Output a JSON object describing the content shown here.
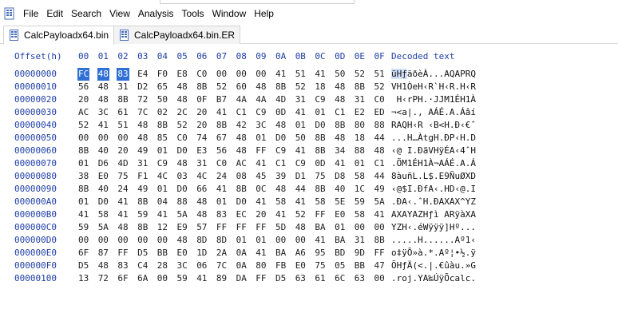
{
  "menu": {
    "items": [
      "File",
      "Edit",
      "Search",
      "View",
      "Analysis",
      "Tools",
      "Window",
      "Help"
    ]
  },
  "tabs": [
    {
      "label": "CalcPayloadx64.bin",
      "active": true
    },
    {
      "label": "CalcPayloadx64.bin.ER",
      "active": false
    }
  ],
  "hex": {
    "offset_header": "Offset(h)",
    "column_headers": [
      "00",
      "01",
      "02",
      "03",
      "04",
      "05",
      "06",
      "07",
      "08",
      "09",
      "0A",
      "0B",
      "0C",
      "0D",
      "0E",
      "0F"
    ],
    "decoded_header": "Decoded text",
    "selection": {
      "row": 0,
      "start": 0,
      "end": 2
    },
    "rows": [
      {
        "offset": "00000000",
        "bytes": [
          "FC",
          "48",
          "83",
          "E4",
          "F0",
          "E8",
          "C0",
          "00",
          "00",
          "00",
          "41",
          "51",
          "41",
          "50",
          "52",
          "51"
        ],
        "decoded_sel": "üHƒ",
        "decoded_rest": "äðèÀ...AQAPRQ"
      },
      {
        "offset": "00000010",
        "bytes": [
          "56",
          "48",
          "31",
          "D2",
          "65",
          "48",
          "8B",
          "52",
          "60",
          "48",
          "8B",
          "52",
          "18",
          "48",
          "8B",
          "52"
        ],
        "decoded_sel": "",
        "decoded_rest": "VH1ÒeH‹R`H‹R.H‹R"
      },
      {
        "offset": "00000020",
        "bytes": [
          "20",
          "48",
          "8B",
          "72",
          "50",
          "48",
          "0F",
          "B7",
          "4A",
          "4A",
          "4D",
          "31",
          "C9",
          "48",
          "31",
          "C0"
        ],
        "decoded_sel": "",
        "decoded_rest": " H‹rPH.·JJM1ÉH1À"
      },
      {
        "offset": "00000030",
        "bytes": [
          "AC",
          "3C",
          "61",
          "7C",
          "02",
          "2C",
          "20",
          "41",
          "C1",
          "C9",
          "0D",
          "41",
          "01",
          "C1",
          "E2",
          "ED"
        ],
        "decoded_sel": "",
        "decoded_rest": "¬<a|., AÁÉ.A.Áâí"
      },
      {
        "offset": "00000040",
        "bytes": [
          "52",
          "41",
          "51",
          "48",
          "8B",
          "52",
          "20",
          "8B",
          "42",
          "3C",
          "48",
          "01",
          "D0",
          "8B",
          "80",
          "88"
        ],
        "decoded_sel": "",
        "decoded_rest": "RAQH‹R ‹B<H.Ð‹€ˆ"
      },
      {
        "offset": "00000050",
        "bytes": [
          "00",
          "00",
          "00",
          "48",
          "85",
          "C0",
          "74",
          "67",
          "48",
          "01",
          "D0",
          "50",
          "8B",
          "48",
          "18",
          "44"
        ],
        "decoded_sel": "",
        "decoded_rest": "...H…ÀtgH.ÐP‹H.D"
      },
      {
        "offset": "00000060",
        "bytes": [
          "8B",
          "40",
          "20",
          "49",
          "01",
          "D0",
          "E3",
          "56",
          "48",
          "FF",
          "C9",
          "41",
          "8B",
          "34",
          "88",
          "48"
        ],
        "decoded_sel": "",
        "decoded_rest": "‹@ I.ÐãVHÿÉA‹4ˆH"
      },
      {
        "offset": "00000070",
        "bytes": [
          "01",
          "D6",
          "4D",
          "31",
          "C9",
          "48",
          "31",
          "C0",
          "AC",
          "41",
          "C1",
          "C9",
          "0D",
          "41",
          "01",
          "C1"
        ],
        "decoded_sel": "",
        "decoded_rest": ".ÖM1ÉH1À¬AÁÉ.A.Á"
      },
      {
        "offset": "00000080",
        "bytes": [
          "38",
          "E0",
          "75",
          "F1",
          "4C",
          "03",
          "4C",
          "24",
          "08",
          "45",
          "39",
          "D1",
          "75",
          "D8",
          "58",
          "44"
        ],
        "decoded_sel": "",
        "decoded_rest": "8àuñL.L$.E9ÑuØXD"
      },
      {
        "offset": "00000090",
        "bytes": [
          "8B",
          "40",
          "24",
          "49",
          "01",
          "D0",
          "66",
          "41",
          "8B",
          "0C",
          "48",
          "44",
          "8B",
          "40",
          "1C",
          "49"
        ],
        "decoded_sel": "",
        "decoded_rest": "‹@$I.ÐfA‹.HD‹@.I"
      },
      {
        "offset": "000000A0",
        "bytes": [
          "01",
          "D0",
          "41",
          "8B",
          "04",
          "88",
          "48",
          "01",
          "D0",
          "41",
          "58",
          "41",
          "58",
          "5E",
          "59",
          "5A"
        ],
        "decoded_sel": "",
        "decoded_rest": ".ÐA‹.ˆH.ÐAXAX^YZ"
      },
      {
        "offset": "000000B0",
        "bytes": [
          "41",
          "58",
          "41",
          "59",
          "41",
          "5A",
          "48",
          "83",
          "EC",
          "20",
          "41",
          "52",
          "FF",
          "E0",
          "58",
          "41"
        ],
        "decoded_sel": "",
        "decoded_rest": "AXAYAZHƒì ARÿàXA"
      },
      {
        "offset": "000000C0",
        "bytes": [
          "59",
          "5A",
          "48",
          "8B",
          "12",
          "E9",
          "57",
          "FF",
          "FF",
          "FF",
          "5D",
          "48",
          "BA",
          "01",
          "00",
          "00"
        ],
        "decoded_sel": "",
        "decoded_rest": "YZH‹.éWÿÿÿ]Hº..."
      },
      {
        "offset": "000000D0",
        "bytes": [
          "00",
          "00",
          "00",
          "00",
          "00",
          "48",
          "8D",
          "8D",
          "01",
          "01",
          "00",
          "00",
          "41",
          "BA",
          "31",
          "8B"
        ],
        "decoded_sel": "",
        "decoded_rest": ".....H......Aº1‹"
      },
      {
        "offset": "000000E0",
        "bytes": [
          "6F",
          "87",
          "FF",
          "D5",
          "BB",
          "E0",
          "1D",
          "2A",
          "0A",
          "41",
          "BA",
          "A6",
          "95",
          "BD",
          "9D",
          "FF"
        ],
        "decoded_sel": "",
        "decoded_rest": "o‡ÿÕ»à.*.Aº¦•½.ÿ"
      },
      {
        "offset": "000000F0",
        "bytes": [
          "D5",
          "48",
          "83",
          "C4",
          "28",
          "3C",
          "06",
          "7C",
          "0A",
          "80",
          "FB",
          "E0",
          "75",
          "05",
          "BB",
          "47"
        ],
        "decoded_sel": "",
        "decoded_rest": "ÕHƒÄ(<.|.€ûàu.»G"
      },
      {
        "offset": "00000100",
        "bytes": [
          "13",
          "72",
          "6F",
          "6A",
          "00",
          "59",
          "41",
          "89",
          "DA",
          "FF",
          "D5",
          "63",
          "61",
          "6C",
          "63",
          "00"
        ],
        "decoded_sel": "",
        "decoded_rest": ".roj.YA‰ÚÿÕcalc."
      }
    ]
  }
}
